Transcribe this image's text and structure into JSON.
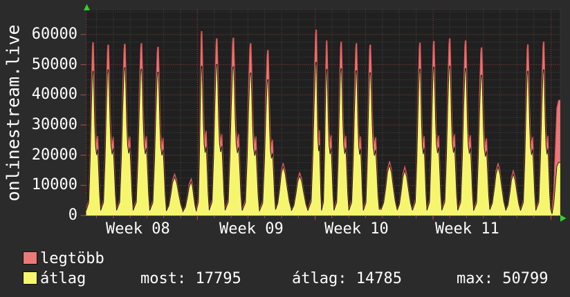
{
  "window": {
    "background": "#2b2b2b"
  },
  "chart_data": {
    "type": "area",
    "title_vertical": "onlinestream.live",
    "xlabel": "",
    "ylabel": "onlinestream.live",
    "ylim": [
      0,
      68240
    ],
    "y_ticks": [
      0,
      10000,
      20000,
      30000,
      40000,
      50000,
      60000
    ],
    "minor_y_step": 2500,
    "x_tick_labels": [
      "Week 08",
      "Week 09",
      "Week 10",
      "Week 11"
    ],
    "week_line_ts": [
      0.2347,
      0.483,
      0.7318,
      0.9806
    ],
    "grid": "dotted",
    "legend_position": "bottom-left",
    "series": [
      {
        "name": "legtöbb",
        "role": "max",
        "fill": "#ec7878",
        "stroke": "#e05555"
      },
      {
        "name": "átlag",
        "role": "avg",
        "fill": "#f6f66e",
        "stroke": "#1a1a1a"
      }
    ],
    "spikes": [
      {
        "t": 0.0146,
        "max": 57300,
        "avg": 47800
      },
      {
        "t": 0.0466,
        "max": 56500,
        "avg": 48300
      },
      {
        "t": 0.0816,
        "max": 56800,
        "avg": 49000
      },
      {
        "t": 0.1166,
        "max": 57000,
        "avg": 48500
      },
      {
        "t": 0.1516,
        "max": 55800,
        "avg": 47500
      },
      {
        "t": 0.1866,
        "max": 13800,
        "avg": 12800
      },
      {
        "t": 0.2216,
        "max": 12200,
        "avg": 11200
      },
      {
        "t": 0.2435,
        "max": 61000,
        "avg": 49500
      },
      {
        "t": 0.2755,
        "max": 58600,
        "avg": 50100
      },
      {
        "t": 0.3105,
        "max": 58800,
        "avg": 49300
      },
      {
        "t": 0.3469,
        "max": 57000,
        "avg": 47200
      },
      {
        "t": 0.3834,
        "max": 54700,
        "avg": 45000
      },
      {
        "t": 0.4155,
        "max": 17400,
        "avg": 16300
      },
      {
        "t": 0.4504,
        "max": 14200,
        "avg": 13200
      },
      {
        "t": 0.4854,
        "max": 61500,
        "avg": 50799
      },
      {
        "t": 0.5073,
        "max": 57900,
        "avg": 48500
      },
      {
        "t": 0.5379,
        "max": 57500,
        "avg": 48700
      },
      {
        "t": 0.57,
        "max": 57000,
        "avg": 48000
      },
      {
        "t": 0.5991,
        "max": 56500,
        "avg": 47300
      },
      {
        "t": 0.6399,
        "max": 18000,
        "avg": 16800
      },
      {
        "t": 0.672,
        "max": 16200,
        "avg": 15000
      },
      {
        "t": 0.7041,
        "max": 57200,
        "avg": 48500
      },
      {
        "t": 0.7332,
        "max": 57700,
        "avg": 49200
      },
      {
        "t": 0.7668,
        "max": 58600,
        "avg": 49500
      },
      {
        "t": 0.8003,
        "max": 57900,
        "avg": 48700
      },
      {
        "t": 0.8338,
        "max": 55600,
        "avg": 46500
      },
      {
        "t": 0.8688,
        "max": 17400,
        "avg": 16200
      },
      {
        "t": 0.9009,
        "max": 14900,
        "avg": 13800
      },
      {
        "t": 0.9315,
        "max": 56600,
        "avg": 47800
      },
      {
        "t": 0.965,
        "max": 57500,
        "avg": 48300
      },
      {
        "t": 0.9942,
        "max": 38200,
        "avg": 17600,
        "partial": true
      }
    ],
    "stats": {
      "most": 17795,
      "atlag": 14785,
      "max": 50799
    }
  },
  "legend": {
    "items": [
      {
        "label": "legtöbb",
        "color": "#ec7878"
      },
      {
        "label": "átlag",
        "color": "#f6f66e"
      }
    ],
    "stats": [
      {
        "text": "most: 17795"
      },
      {
        "text": "átlag: 14785"
      },
      {
        "text": "max: 50799"
      }
    ]
  },
  "colors": {
    "background": "#2b2b2b",
    "canvas": "#202020",
    "minor_grid": "#474747",
    "major_grid": "#9a4242",
    "tick": "#c84848",
    "arrow": "#2fd42f",
    "text": "#ffffff",
    "max_fill": "#ec7878",
    "max_stroke": "#e05555",
    "avg_fill": "#f6f66e",
    "avg_stroke": "#1a1a1a"
  }
}
